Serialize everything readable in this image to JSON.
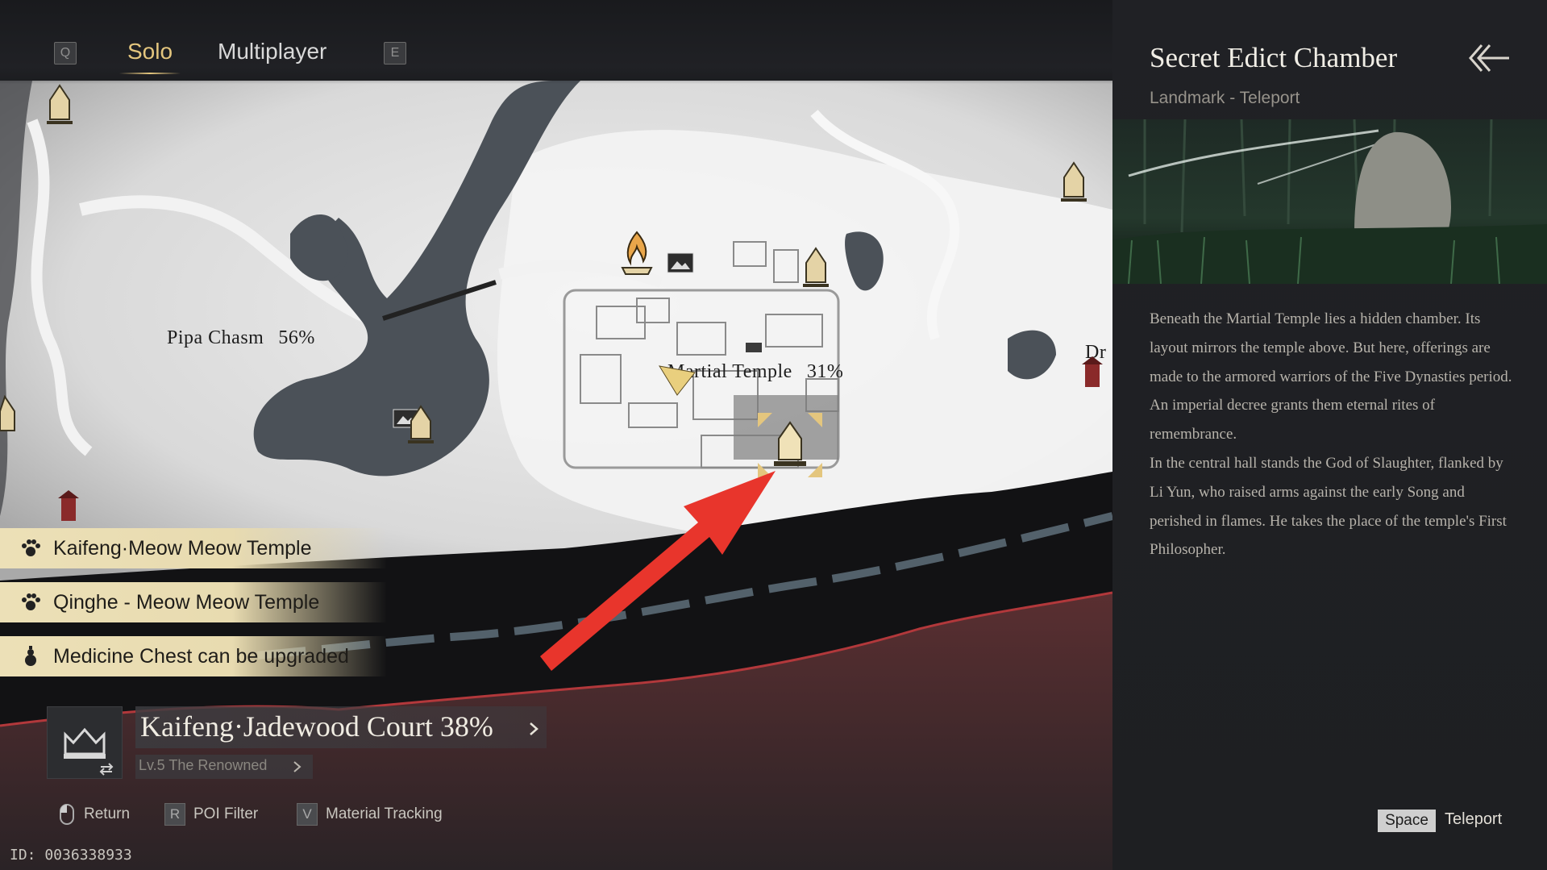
{
  "header": {
    "left_key": "Q",
    "right_key": "E",
    "tabs": [
      {
        "label": "Solo",
        "active": true
      },
      {
        "label": "Multiplayer",
        "active": false
      }
    ]
  },
  "map": {
    "labels": [
      {
        "name": "Pipa Chasm",
        "percent": "56%"
      },
      {
        "name": "Martial Temple",
        "percent": "31%"
      },
      {
        "name": "Dr",
        "percent": ""
      }
    ],
    "markers": [
      "landmark-icon",
      "campfire-icon",
      "vista-icon",
      "selected-landmark-icon",
      "player-arrow-icon",
      "shrine-icon"
    ]
  },
  "notifications": [
    {
      "icon": "paw-icon",
      "text": "Kaifeng·Meow Meow Temple"
    },
    {
      "icon": "paw-icon",
      "text": "Qinghe - Meow Meow Temple"
    },
    {
      "icon": "gourd-icon",
      "text": "Medicine Chest can be upgraded"
    }
  ],
  "region": {
    "title": "Kaifeng·Jadewood Court 38%",
    "subtitle": "Lv.5 The Renowned"
  },
  "hints": [
    {
      "key": "",
      "label": "Return"
    },
    {
      "key": "R",
      "label": "POI Filter"
    },
    {
      "key": "V",
      "label": "Material Tracking"
    }
  ],
  "player_id": "ID: 0036338933",
  "panel": {
    "title": "Secret Edict Chamber",
    "subtitle": "Landmark - Teleport",
    "description": [
      "Beneath the Martial Temple lies a hidden chamber. Its layout mirrors the temple above. But here, offerings are made to the armored warriors of the Five Dynasties period. An imperial decree grants them eternal rites of remembrance.",
      "In the central hall stands the God of Slaughter, flanked by Li Yun, who raised arms against the early Song and perished in flames. He takes the place of the temple's First Philosopher."
    ],
    "action_key": "Space",
    "action_label": "Teleport"
  },
  "colors": {
    "accent_gold": "#e4c67e",
    "annotation_arrow": "#e8352c",
    "notification_bg": "#e8dbb0"
  }
}
